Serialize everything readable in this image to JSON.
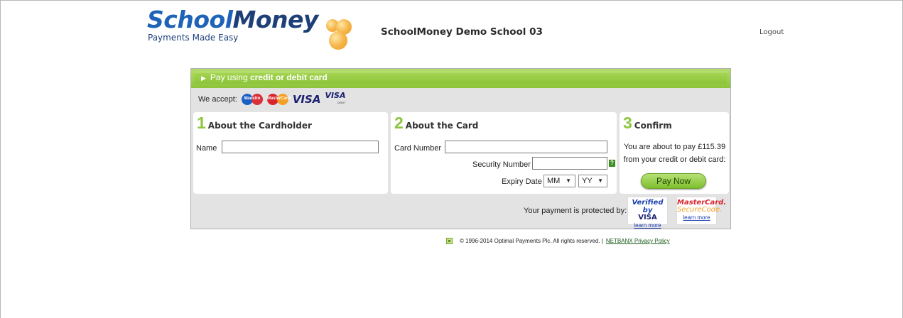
{
  "header": {
    "logo_part1": "School",
    "logo_part2": "Money",
    "logo_tagline": "Payments Made Easy",
    "school_name": "SchoolMoney Demo School 03",
    "logout_label": "Logout"
  },
  "payment": {
    "bar_prefix": "Pay using",
    "bar_method": "credit or debit card",
    "we_accept_label": "We accept:",
    "card_logos": {
      "maestro": "Maestro",
      "mastercard": "MasterCard",
      "visa": "VISA",
      "visa_debit": "VISA",
      "visa_debit_sub": "DEBIT"
    },
    "sections": [
      {
        "number": "1",
        "title": "About the Cardholder"
      },
      {
        "number": "2",
        "title": "About the Card"
      },
      {
        "number": "3",
        "title": "Confirm"
      }
    ],
    "cardholder": {
      "name_label": "Name",
      "name_value": ""
    },
    "card": {
      "number_label": "Card Number",
      "number_value": "",
      "security_label": "Security Number",
      "security_value": "",
      "security_help": "?",
      "expiry_label": "Expiry Date",
      "expiry_month": "MM",
      "expiry_year": "YY"
    },
    "confirm": {
      "line1": "You are about to pay  £115.39",
      "line2": "from your credit or debit card:",
      "pay_button": "Pay Now"
    },
    "protection": {
      "text": "Your payment is protected by:",
      "verified_line1": "Verified by",
      "verified_line2": "VISA",
      "verified_learn": "learn more",
      "mc_line1": "MasterCard.",
      "mc_line2": "SecureCode.",
      "mc_learn": "learn more"
    }
  },
  "footer": {
    "copyright": "© 1996-2014 Optimal Payments Plc. All rights reserved.  |",
    "privacy_link": "NETBANX Privacy Policy"
  }
}
